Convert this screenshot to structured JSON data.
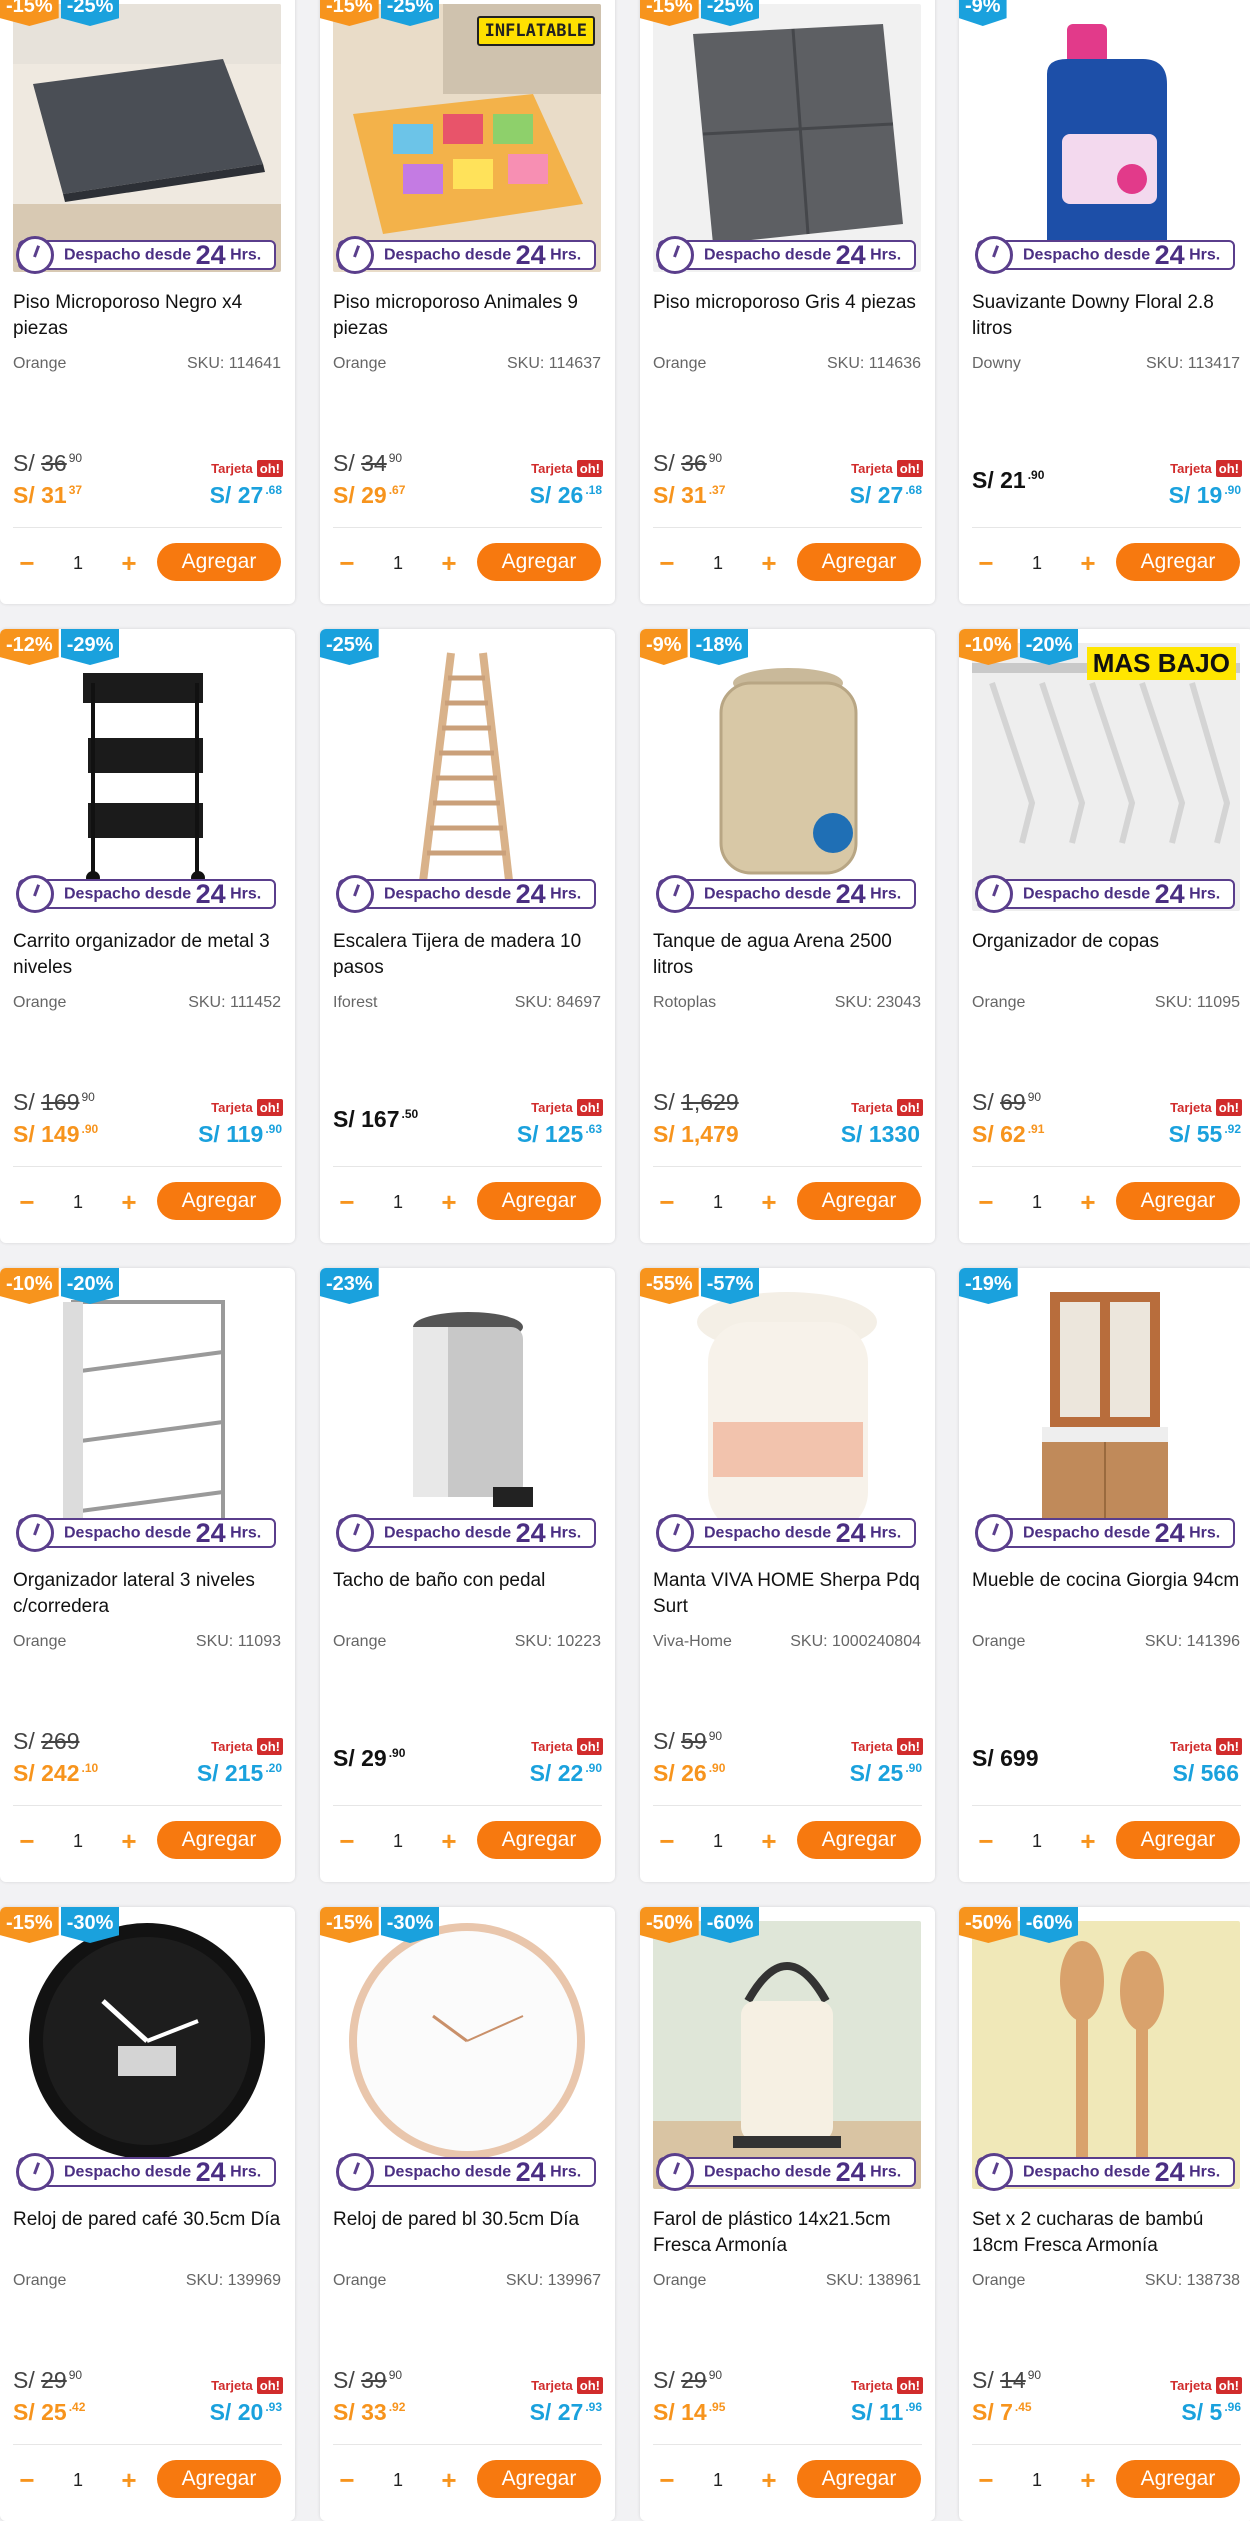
{
  "labels": {
    "despacho_text": "Despacho desde",
    "despacho_big": "24",
    "despacho_hrs": "Hrs.",
    "tarjeta": "Tarjeta",
    "oh": "oh!",
    "add_button": "Agregar",
    "minus": "−",
    "plus": "+"
  },
  "products": [
    {
      "name": "Piso Microporoso Negro x4 piezas",
      "brand": "Orange",
      "sku": "SKU: 114641",
      "discounts": [
        "-15%",
        "-25%"
      ],
      "old": "36",
      "old_cents": "90",
      "price": "S/ 31",
      "price_cents": "37",
      "card": "S/ 27",
      "card_cents": ".68",
      "badge": ""
    },
    {
      "name": "Piso microporoso Animales 9 piezas",
      "brand": "Orange",
      "sku": "SKU: 114637",
      "discounts": [
        "-15%",
        "-25%"
      ],
      "old": "34",
      "old_cents": "90",
      "price": "S/ 29",
      "price_cents": ".67",
      "card": "S/ 26",
      "card_cents": ".18",
      "badge": "INFLATABLE"
    },
    {
      "name": "Piso microporoso Gris 4 piezas",
      "brand": "Orange",
      "sku": "SKU: 114636",
      "discounts": [
        "-15%",
        "-25%"
      ],
      "old": "36",
      "old_cents": "90",
      "price": "S/ 31",
      "price_cents": ".37",
      "card": "S/ 27",
      "card_cents": ".68",
      "badge": ""
    },
    {
      "name": "Suavizante Downy Floral 2.8 litros",
      "brand": "Downy",
      "sku": "SKU: 113417",
      "discounts": [
        "-9%"
      ],
      "old": "",
      "old_cents": "",
      "price": "S/ 21",
      "price_cents": ".90",
      "card": "S/ 19",
      "card_cents": ".90",
      "badge": ""
    },
    {
      "name": "Carrito organizador de metal 3 niveles",
      "brand": "Orange",
      "sku": "SKU: 111452",
      "discounts": [
        "-12%",
        "-29%"
      ],
      "old": "169",
      "old_cents": "90",
      "price": "S/ 149",
      "price_cents": ".90",
      "card": "S/ 119",
      "card_cents": ".90",
      "badge": ""
    },
    {
      "name": "Escalera Tijera de madera 10 pasos",
      "brand": "Iforest",
      "sku": "SKU: 84697",
      "discounts": [
        "-25%"
      ],
      "old": "",
      "old_cents": "",
      "price": "S/ 167",
      "price_cents": ".50",
      "card": "S/ 125",
      "card_cents": ".63",
      "badge": ""
    },
    {
      "name": "Tanque de agua Arena 2500 litros",
      "brand": "Rotoplas",
      "sku": "SKU: 23043",
      "discounts": [
        "-9%",
        "-18%"
      ],
      "old": "1,629",
      "old_cents": "",
      "price": "S/ 1,479",
      "price_cents": "",
      "card": "S/ 1330",
      "card_cents": "",
      "badge": ""
    },
    {
      "name": "Organizador de copas",
      "brand": "Orange",
      "sku": "SKU: 11095",
      "discounts": [
        "-10%",
        "-20%"
      ],
      "old": "69",
      "old_cents": "90",
      "price": "S/ 62",
      "price_cents": ".91",
      "card": "S/ 55",
      "card_cents": ".92",
      "badge": "MAS BAJO"
    },
    {
      "name": "Organizador lateral 3 niveles c/corredera",
      "brand": "Orange",
      "sku": "SKU: 11093",
      "discounts": [
        "-10%",
        "-20%"
      ],
      "old": "269",
      "old_cents": "",
      "price": "S/ 242",
      "price_cents": ".10",
      "card": "S/ 215",
      "card_cents": ".20",
      "badge": ""
    },
    {
      "name": "Tacho de baño con pedal",
      "brand": "Orange",
      "sku": "SKU: 10223",
      "discounts": [
        "-23%"
      ],
      "old": "",
      "old_cents": "",
      "price": "S/ 29",
      "price_cents": ".90",
      "card": "S/ 22",
      "card_cents": ".90",
      "badge": ""
    },
    {
      "name": "Manta VIVA HOME Sherpa Pdq Surt",
      "brand": "Viva-Home",
      "sku": "SKU: 1000240804",
      "discounts": [
        "-55%",
        "-57%"
      ],
      "old": "59",
      "old_cents": "90",
      "price": "S/ 26",
      "price_cents": ".90",
      "card": "S/ 25",
      "card_cents": ".90",
      "badge": ""
    },
    {
      "name": "Mueble de cocina Giorgia 94cm",
      "brand": "Orange",
      "sku": "SKU: 141396",
      "discounts": [
        "-19%"
      ],
      "old": "",
      "old_cents": "",
      "price": "S/ 699",
      "price_cents": "",
      "card": "S/ 566",
      "card_cents": "",
      "badge": ""
    },
    {
      "name": "Reloj de pared café 30.5cm Día",
      "brand": "Orange",
      "sku": "SKU: 139969",
      "discounts": [
        "-15%",
        "-30%"
      ],
      "old": "29",
      "old_cents": "90",
      "price": "S/ 25",
      "price_cents": ".42",
      "card": "S/ 20",
      "card_cents": ".93",
      "badge": ""
    },
    {
      "name": "Reloj de pared bl 30.5cm Día",
      "brand": "Orange",
      "sku": "SKU: 139967",
      "discounts": [
        "-15%",
        "-30%"
      ],
      "old": "39",
      "old_cents": "90",
      "price": "S/ 33",
      "price_cents": ".92",
      "card": "S/ 27",
      "card_cents": ".93",
      "badge": ""
    },
    {
      "name": "Farol de plástico 14x21.5cm Fresca Armonía",
      "brand": "Orange",
      "sku": "SKU: 138961",
      "discounts": [
        "-50%",
        "-60%"
      ],
      "old": "29",
      "old_cents": "90",
      "price": "S/ 14",
      "price_cents": ".95",
      "card": "S/ 11",
      "card_cents": ".96",
      "badge": ""
    },
    {
      "name": "Set x 2 cucharas de bambú 18cm Fresca Armonía",
      "brand": "Orange",
      "sku": "SKU: 138738",
      "discounts": [
        "-50%",
        "-60%"
      ],
      "old": "14",
      "old_cents": "90",
      "price": "S/ 7",
      "price_cents": ".45",
      "card": "S/ 5",
      "card_cents": ".96",
      "badge": ""
    }
  ],
  "qty_default": "1"
}
